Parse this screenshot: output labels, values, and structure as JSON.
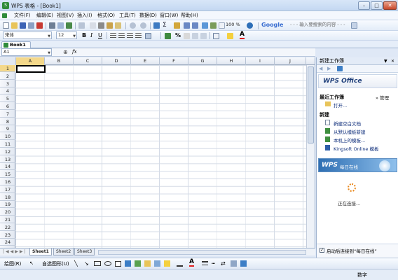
{
  "window": {
    "title": "WPS 表格 - [Book1]",
    "min": "–",
    "max": "□",
    "close": "✕"
  },
  "menu": [
    "文件(F)",
    "编辑(E)",
    "视图(V)",
    "插入(I)",
    "格式(O)",
    "工具(T)",
    "数据(D)",
    "窗口(W)",
    "帮助(H)"
  ],
  "toolbar": {
    "zoom": "100 %",
    "search_brand": "Google",
    "search_placeholder": "- - - 输入要搜索的内容 - - -"
  },
  "format": {
    "font": "宋体",
    "size": "12",
    "bold": "B",
    "italic": "I",
    "underline": "U",
    "percent": "%"
  },
  "doc_tab": "Book1",
  "formula": {
    "cell_ref": "A1",
    "fx": "fx"
  },
  "grid": {
    "columns": [
      "A",
      "B",
      "C",
      "D",
      "E",
      "F",
      "G",
      "H",
      "I",
      "J"
    ],
    "rows": [
      "1",
      "2",
      "3",
      "4",
      "5",
      "6",
      "7",
      "8",
      "9",
      "10",
      "11",
      "12",
      "13",
      "14",
      "15",
      "16",
      "17",
      "18",
      "19",
      "20",
      "21",
      "22",
      "23",
      "24"
    ]
  },
  "sheets": [
    "Sheet1",
    "Sheet2",
    "Sheet3"
  ],
  "task_pane": {
    "title": "新建工作簿",
    "logo": "WPS Office",
    "recent_heading": "最近工作簿",
    "manage": "» 管理",
    "open": "打开...",
    "new_heading": "新建",
    "new_blank": "新建空白文档",
    "from_default": "从默认模板新建",
    "local_template": "本机上的模板...",
    "online_template": "Kingsoft Online 模板",
    "online_logo": "WPS",
    "online_text": "每日在线",
    "connecting": "正在连接...",
    "startup_checkbox": "启动后连接到“每日在线”"
  },
  "drawbar": {
    "draw": "绘图(R)",
    "autoshape": "自选图形(U)"
  },
  "status": {
    "num": "数字"
  },
  "colors": {
    "accent": "#2f6fb3",
    "grid": "#d4dbe6",
    "wps_green": "#2f8b3a"
  }
}
